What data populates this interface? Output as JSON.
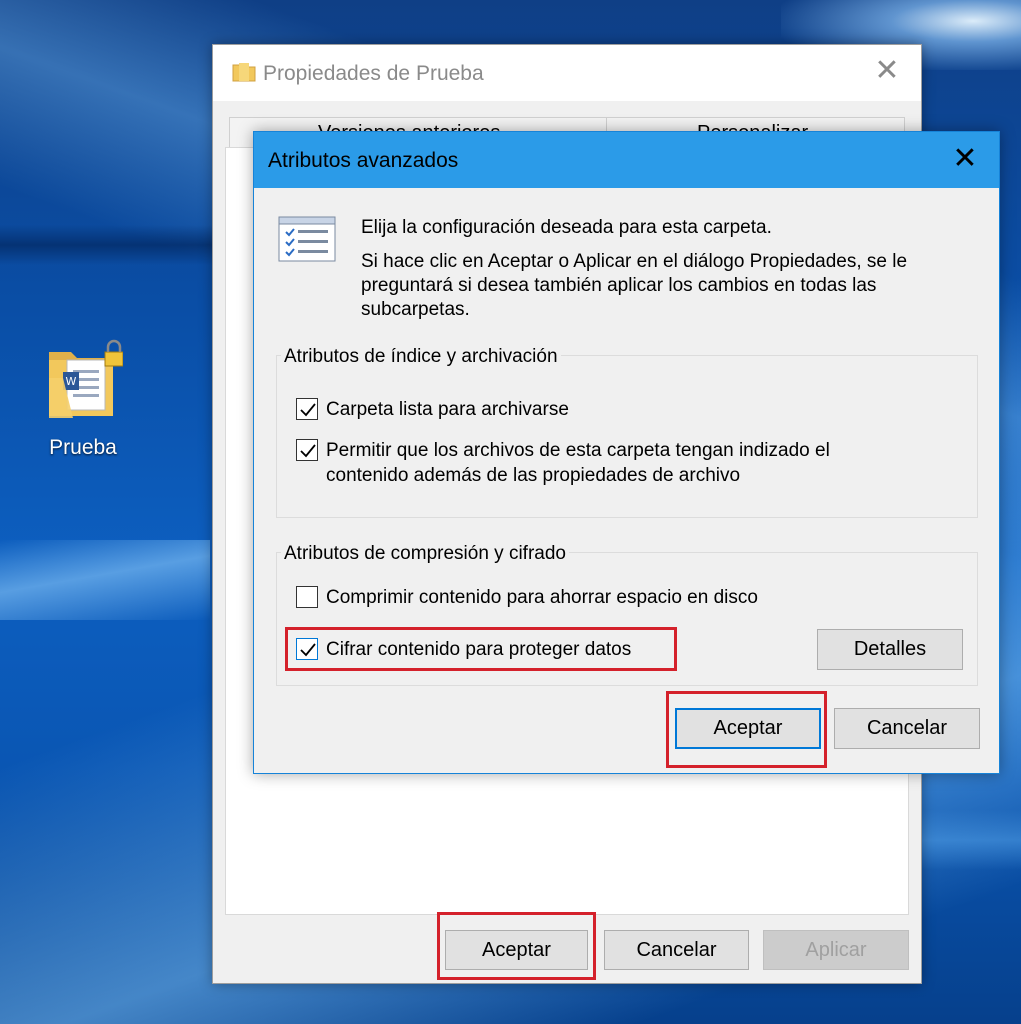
{
  "desktop": {
    "icon_label": "Prueba"
  },
  "properties_window": {
    "title": "Propiedades de Prueba",
    "tabs": [
      "Versiones anteriores",
      "Personalizar"
    ],
    "buttons": {
      "accept": "Aceptar",
      "cancel": "Cancelar",
      "apply": "Aplicar"
    }
  },
  "advanced_dialog": {
    "title": "Atributos avanzados",
    "intro_line": "Elija la configuración deseada para esta carpeta.",
    "intro_detail": "Si hace clic en Aceptar o Aplicar en el diálogo Propiedades, se le preguntará si desea también aplicar los cambios en todas las subcarpetas.",
    "index_group": {
      "legend": "Atributos de índice y archivación",
      "options": [
        {
          "label": "Carpeta lista para archivarse",
          "checked": true
        },
        {
          "label": "Permitir que los archivos de esta carpeta tengan indizado el contenido además de las propiedades de archivo",
          "checked": true
        }
      ]
    },
    "compress_group": {
      "legend": "Atributos de compresión y cifrado",
      "options": [
        {
          "label": "Comprimir contenido para ahorrar espacio en disco",
          "checked": false
        },
        {
          "label": "Cifrar contenido para proteger datos",
          "checked": true
        }
      ],
      "details_button": "Detalles"
    },
    "buttons": {
      "accept": "Aceptar",
      "cancel": "Cancelar"
    }
  },
  "colors": {
    "dialog_titlebar": "#2b9be8",
    "highlight": "#d4212b",
    "focus_border": "#0078d7"
  }
}
